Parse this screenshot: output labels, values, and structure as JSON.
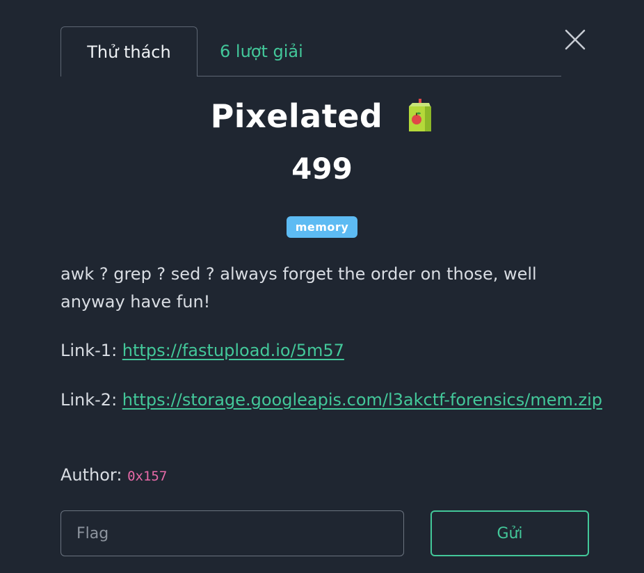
{
  "tabs": {
    "challenge_label": "Thử thách",
    "solves_label": "6 lượt giải"
  },
  "close_icon": "close-icon",
  "challenge": {
    "title": "Pixelated",
    "title_icon": "juice-box-icon",
    "value": "499",
    "tag": "memory",
    "description": "awk ? grep ? sed ? always forget the order on those, well anyway have fun!",
    "link1_label": "Link-1: ",
    "link1_url": "https://fastupload.io/5m57",
    "link2_label": "Link-2: ",
    "link2_url": "https://storage.googleapis.com/l3akctf-forensics/mem.zip",
    "author_label": "Author: ",
    "author_name": "0x157"
  },
  "form": {
    "flag_placeholder": "Flag",
    "flag_value": "",
    "submit_label": "Gửi"
  },
  "colors": {
    "background": "#1f2631",
    "accent": "#43c89a",
    "tag": "#5dbbf3",
    "author_code": "#e76aa8"
  }
}
